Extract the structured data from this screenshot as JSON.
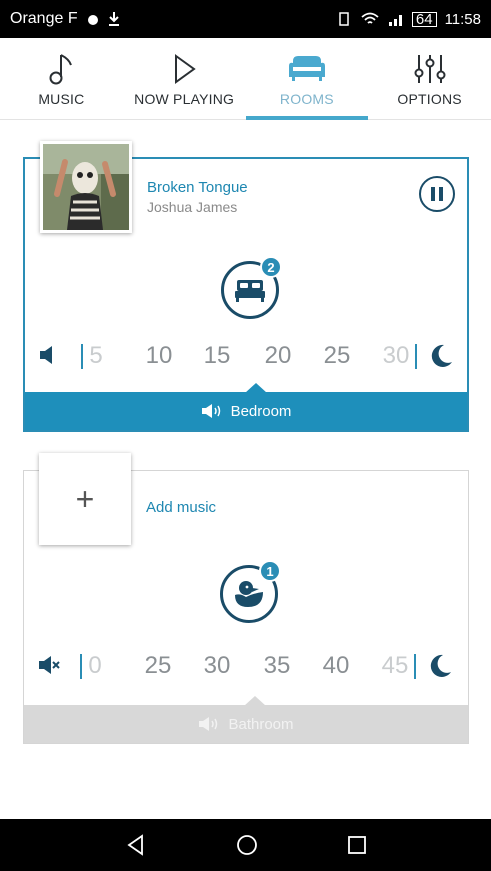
{
  "status_bar": {
    "carrier": "Orange F",
    "battery": "64",
    "time": "11:58"
  },
  "tabs": [
    {
      "label": "MUSIC",
      "icon": "music-note-icon",
      "active": false
    },
    {
      "label": "NOW PLAYING",
      "icon": "play-icon",
      "active": false
    },
    {
      "label": "ROOMS",
      "icon": "sofa-icon",
      "active": true
    },
    {
      "label": "OPTIONS",
      "icon": "sliders-icon",
      "active": false
    }
  ],
  "rooms": [
    {
      "name": "Bedroom",
      "track_title": "Broken Tongue",
      "artist": "Joshua James",
      "icon": "bed-icon",
      "speaker_count": "2",
      "volume_ticks": [
        "5",
        "10",
        "15",
        "20",
        "25",
        "30"
      ],
      "volume_level": 20,
      "active": true
    },
    {
      "name": "Bathroom",
      "add_music_label": "Add music",
      "add_symbol": "+",
      "icon": "duck-icon",
      "speaker_count": "1",
      "volume_ticks": [
        "0",
        "25",
        "30",
        "35",
        "40",
        "45"
      ],
      "volume_level": 35,
      "active": false
    }
  ],
  "colors": {
    "accent": "#1e8fbb",
    "dark_icon": "#1a4c68",
    "active_tab": "#7fb4cc"
  }
}
